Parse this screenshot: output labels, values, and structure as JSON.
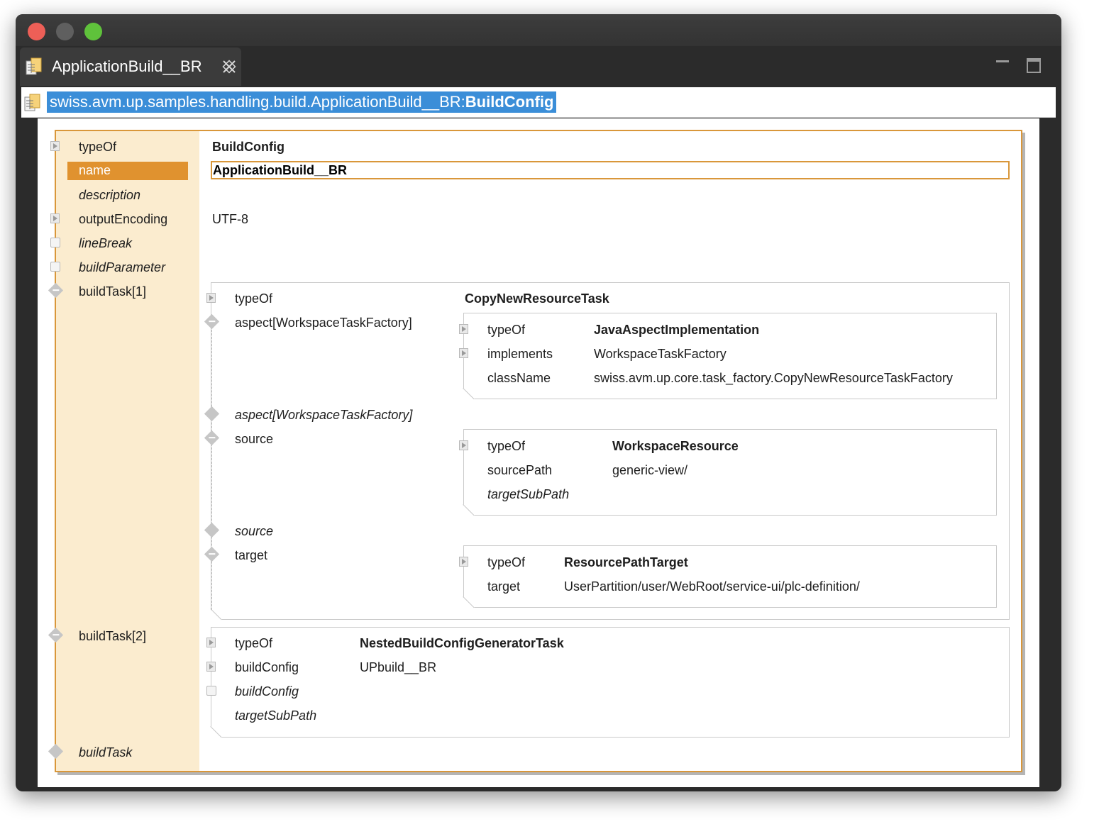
{
  "window": {
    "traffic_lights": [
      "#ed5f57",
      "#5f5f5f",
      "#5fc23b"
    ]
  },
  "tab": {
    "title": "ApplicationBuild__BR",
    "icon": "document-table-icon",
    "close_icon": "close-icon"
  },
  "breadcrumb": {
    "prefix": "swiss.avm.up.samples.handling.build.ApplicationBuild__BR:",
    "type": "BuildConfig"
  },
  "colors": {
    "accent": "#e0922f",
    "key_column_bg": "#fbeccf",
    "selection_blue": "#3b8ed8"
  },
  "root": {
    "typeOf_key": "typeOf",
    "typeOf_val": "BuildConfig",
    "name_key": "name",
    "name_val": "ApplicationBuild__BR",
    "description_key": "description",
    "outputEncoding_key": "outputEncoding",
    "outputEncoding_val": "UTF-8",
    "lineBreak_key": "lineBreak",
    "buildParameter_key": "buildParameter",
    "buildTask1_key": "buildTask[1]",
    "buildTask2_key": "buildTask[2]",
    "buildTask_key": "buildTask"
  },
  "task1": {
    "typeOf_key": "typeOf",
    "typeOf_val": "CopyNewResourceTask",
    "aspect_key": "aspect[WorkspaceTaskFactory]",
    "aspect_empty_key": "aspect[WorkspaceTaskFactory]",
    "source_key": "source",
    "source_empty_key": "source",
    "target_key": "target",
    "aspect": {
      "typeOf_key": "typeOf",
      "typeOf_val": "JavaAspectImplementation",
      "implements_key": "implements",
      "implements_val": "WorkspaceTaskFactory",
      "className_key": "className",
      "className_val": "swiss.avm.up.core.task_factory.CopyNewResourceTaskFactory"
    },
    "source": {
      "typeOf_key": "typeOf",
      "typeOf_val": "WorkspaceResource",
      "sourcePath_key": "sourcePath",
      "sourcePath_val": "generic-view/",
      "targetSubPath_key": "targetSubPath"
    },
    "target": {
      "typeOf_key": "typeOf",
      "typeOf_val": "ResourcePathTarget",
      "target_key": "target",
      "target_val": "UserPartition/user/WebRoot/service-ui/plc-definition/"
    }
  },
  "task2": {
    "typeOf_key": "typeOf",
    "typeOf_val": "NestedBuildConfigGeneratorTask",
    "buildConfig_key": "buildConfig",
    "buildConfig_val": "UPbuild__BR",
    "buildConfig_empty_key": "buildConfig",
    "targetSubPath_key": "targetSubPath"
  }
}
